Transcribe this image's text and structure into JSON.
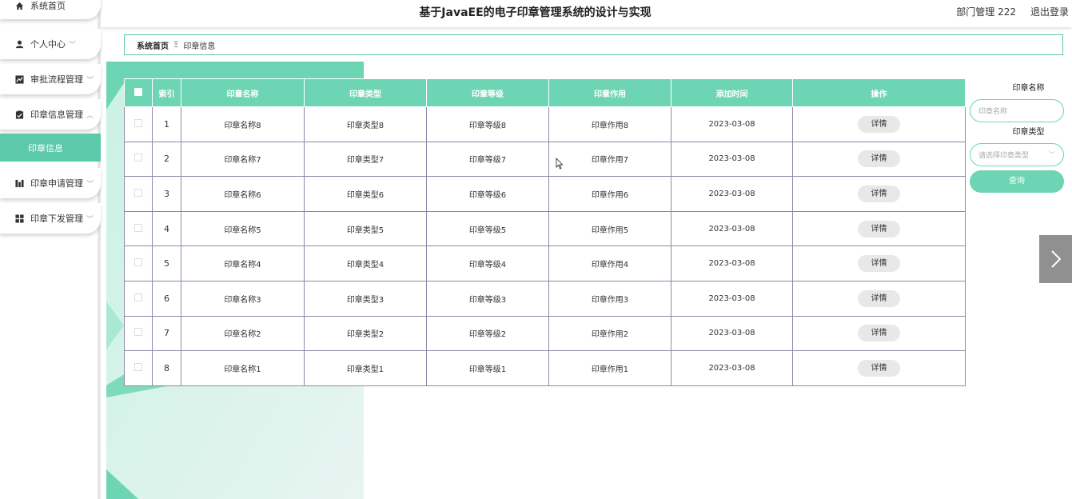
{
  "header": {
    "title": "基于JavaEE的电子印章管理系统的设计与实现",
    "user": "部门管理 222",
    "logout": "退出登录"
  },
  "sidebar": {
    "items": [
      {
        "label": "系统首页",
        "icon": "home-icon"
      },
      {
        "label": "个人中心",
        "icon": "user-icon"
      },
      {
        "label": "审批流程管理",
        "icon": "chart-icon"
      },
      {
        "label": "印章信息管理",
        "icon": "clipboard-icon"
      },
      {
        "label": "印章申请管理",
        "icon": "bar-chart-icon"
      },
      {
        "label": "印章下发管理",
        "icon": "grid-icon"
      }
    ],
    "active_sub": "印章信息"
  },
  "breadcrumb": {
    "home": "系统首页",
    "separator": "Ξ",
    "current": "印章信息"
  },
  "table": {
    "headers": [
      "索引",
      "印章名称",
      "印章类型",
      "印章等级",
      "印章作用",
      "添加时间",
      "操作"
    ],
    "rows": [
      {
        "index": "1",
        "name": "印章名称8",
        "type": "印章类型8",
        "level": "印章等级8",
        "use": "印章作用8",
        "time": "2023-03-08",
        "action": "详情"
      },
      {
        "index": "2",
        "name": "印章名称7",
        "type": "印章类型7",
        "level": "印章等级7",
        "use": "印章作用7",
        "time": "2023-03-08",
        "action": "详情"
      },
      {
        "index": "3",
        "name": "印章名称6",
        "type": "印章类型6",
        "level": "印章等级6",
        "use": "印章作用6",
        "time": "2023-03-08",
        "action": "详情"
      },
      {
        "index": "4",
        "name": "印章名称5",
        "type": "印章类型5",
        "level": "印章等级5",
        "use": "印章作用5",
        "time": "2023-03-08",
        "action": "详情"
      },
      {
        "index": "5",
        "name": "印章名称4",
        "type": "印章类型4",
        "level": "印章等级4",
        "use": "印章作用4",
        "time": "2023-03-08",
        "action": "详情"
      },
      {
        "index": "6",
        "name": "印章名称3",
        "type": "印章类型3",
        "level": "印章等级3",
        "use": "印章作用3",
        "time": "2023-03-08",
        "action": "详情"
      },
      {
        "index": "7",
        "name": "印章名称2",
        "type": "印章类型2",
        "level": "印章等级2",
        "use": "印章作用2",
        "time": "2023-03-08",
        "action": "详情"
      },
      {
        "index": "8",
        "name": "印章名称1",
        "type": "印章类型1",
        "level": "印章等级1",
        "use": "印章作用1",
        "time": "2023-03-08",
        "action": "详情"
      }
    ]
  },
  "search": {
    "name_label": "印章名称",
    "name_placeholder": "印章名称",
    "type_label": "印章类型",
    "type_placeholder": "请选择印章类型",
    "query_button": "查询"
  },
  "colors": {
    "accent": "#6dd5b3",
    "accent_dark": "#5cc9aa",
    "arrow_bg": "#909090"
  }
}
